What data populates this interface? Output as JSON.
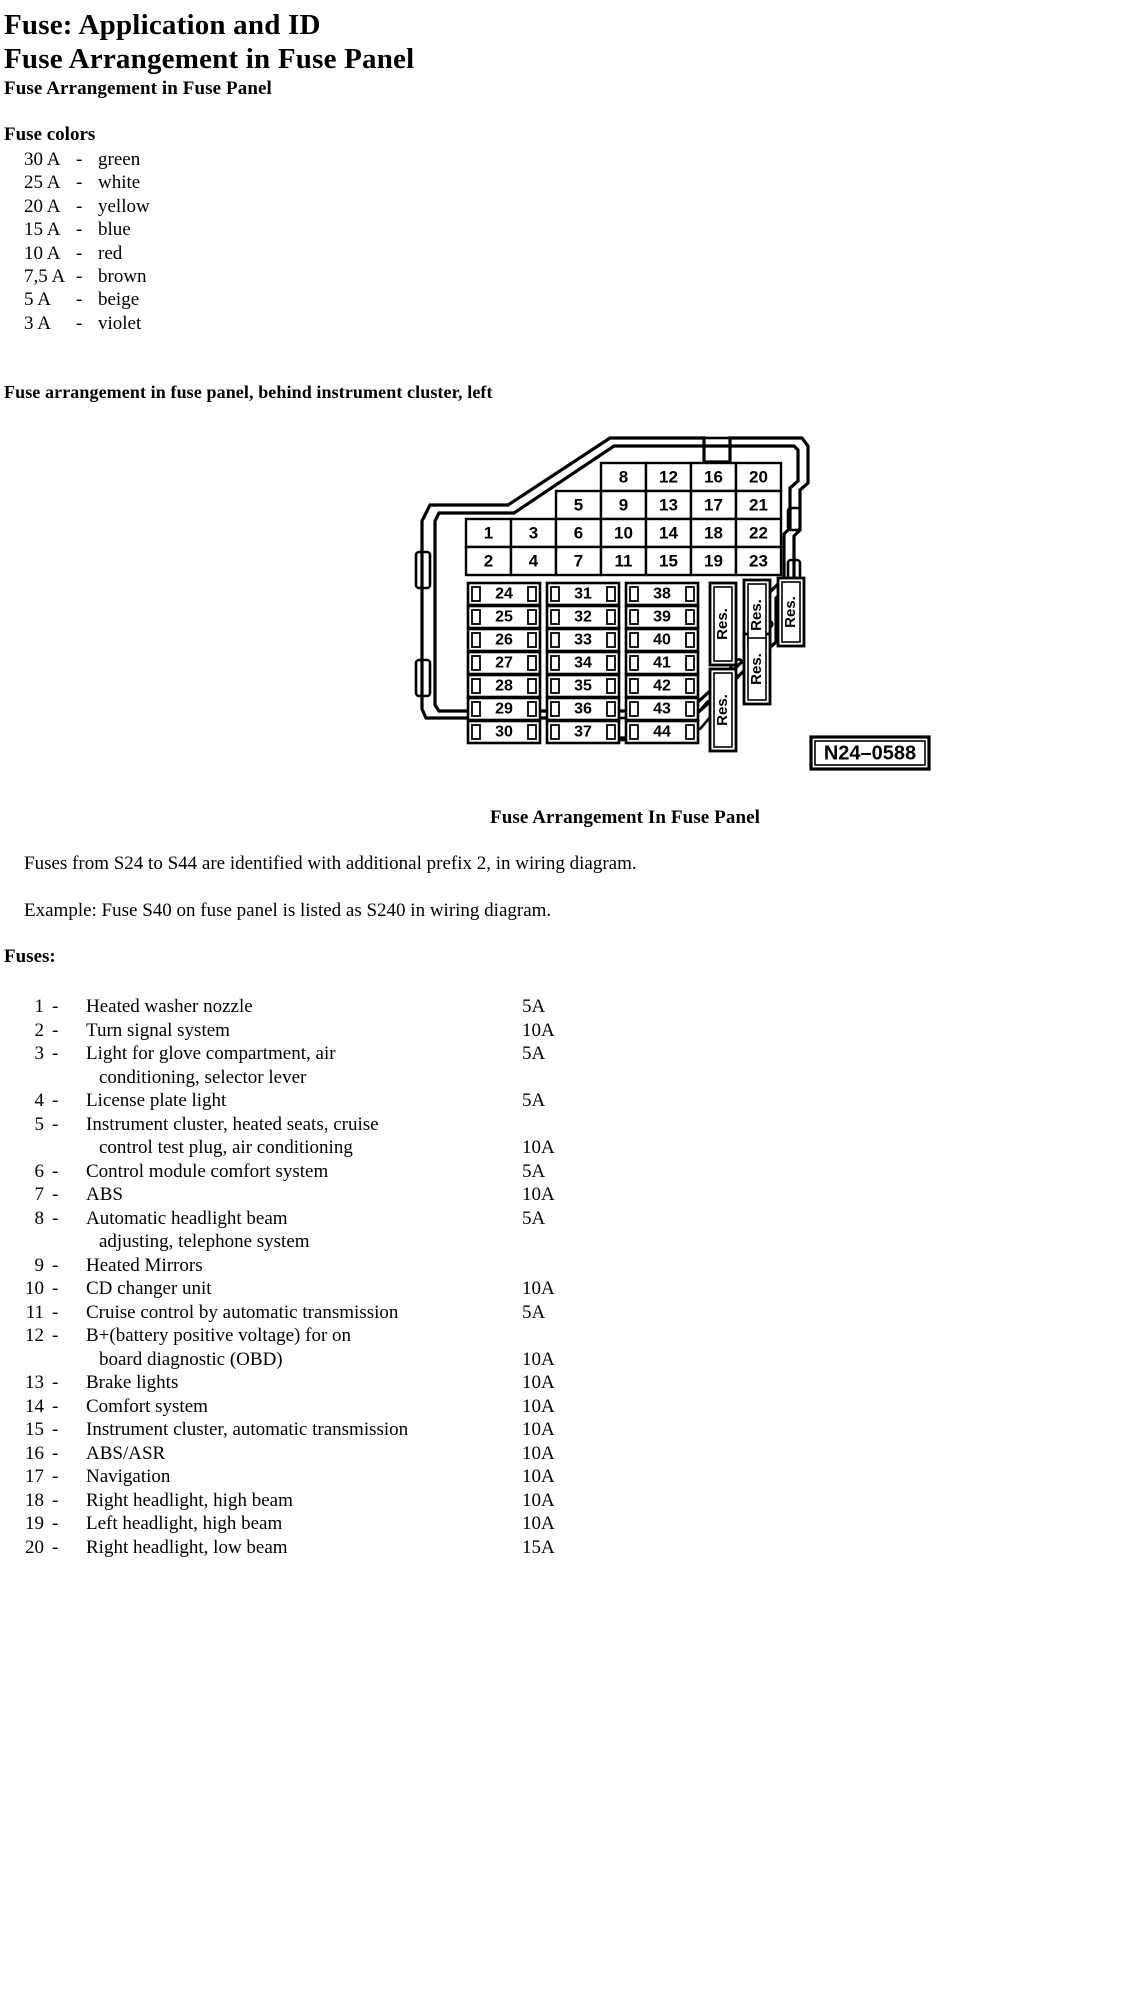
{
  "document": {
    "title_line_1": "Fuse: Application and ID",
    "title_line_2": "Fuse Arrangement in Fuse Panel",
    "subtitle": "Fuse Arrangement in Fuse Panel"
  },
  "fuse_colors": {
    "heading": "Fuse colors",
    "rows": [
      {
        "amp": "30 A",
        "dash": "-",
        "color": "green"
      },
      {
        "amp": "25 A",
        "dash": "-",
        "color": "white"
      },
      {
        "amp": "20 A",
        "dash": "-",
        "color": "yellow"
      },
      {
        "amp": "15 A",
        "dash": "-",
        "color": "blue"
      },
      {
        "amp": "10 A",
        "dash": "-",
        "color": "red"
      },
      {
        "amp": "7,5 A",
        "dash": "-",
        "color": "brown"
      },
      {
        "amp": "5 A",
        "dash": "-",
        "color": "beige"
      },
      {
        "amp": "3 A",
        "dash": "-",
        "color": "violet"
      }
    ]
  },
  "diagram": {
    "heading": "Fuse arrangement in fuse panel, behind instrument cluster, left",
    "caption": "Fuse Arrangement In Fuse Panel",
    "part_number": "N24–0588",
    "reserve_label": "Res.",
    "top_grid": {
      "row_1": [
        "8",
        "12",
        "16",
        "20"
      ],
      "row_2": [
        "5",
        "9",
        "13",
        "17",
        "21"
      ],
      "row_3": [
        "1",
        "3",
        "6",
        "10",
        "14",
        "18",
        "22"
      ],
      "row_4": [
        "2",
        "4",
        "7",
        "11",
        "15",
        "19",
        "23"
      ]
    },
    "bottom_grid": {
      "column_1": [
        "24",
        "25",
        "26",
        "27",
        "28",
        "29",
        "30"
      ],
      "column_2": [
        "31",
        "32",
        "33",
        "34",
        "35",
        "36",
        "37"
      ],
      "column_3": [
        "38",
        "39",
        "40",
        "41",
        "42",
        "43",
        "44"
      ]
    },
    "reserve_slots_count": 5
  },
  "notes": {
    "note_1": "Fuses from S24 to S44 are identified with additional prefix 2, in wiring diagram.",
    "note_2": "Example: Fuse S40 on fuse panel is listed as S240 in wiring diagram."
  },
  "fuses": {
    "heading": "Fuses:",
    "items": [
      {
        "num": "1",
        "dash": "-",
        "desc": "Heated washer nozzle",
        "desc2": "",
        "amp": "5A",
        "amp_on_line": 1
      },
      {
        "num": "2",
        "dash": "-",
        "desc": "Turn signal system",
        "desc2": "",
        "amp": "10A",
        "amp_on_line": 1
      },
      {
        "num": "3",
        "dash": "-",
        "desc": "Light for glove compartment, air",
        "desc2": "conditioning, selector lever",
        "amp": "5A",
        "amp_on_line": 1
      },
      {
        "num": "4",
        "dash": "-",
        "desc": "License plate light",
        "desc2": "",
        "amp": "5A",
        "amp_on_line": 1
      },
      {
        "num": "5",
        "dash": "-",
        "desc": "Instrument cluster, heated seats, cruise",
        "desc2": "control test plug, air conditioning",
        "amp": "10A",
        "amp_on_line": 2
      },
      {
        "num": "6",
        "dash": "-",
        "desc": "Control module comfort system",
        "desc2": "",
        "amp": "5A",
        "amp_on_line": 1
      },
      {
        "num": "7",
        "dash": "-",
        "desc": "ABS",
        "desc2": "",
        "amp": "10A",
        "amp_on_line": 1
      },
      {
        "num": "8",
        "dash": "-",
        "desc": "Automatic headlight beam",
        "desc2": "adjusting, telephone system",
        "amp": "5A",
        "amp_on_line": 1
      },
      {
        "num": "9",
        "dash": "-",
        "desc": "Heated Mirrors",
        "desc2": "",
        "amp": "",
        "amp_on_line": 1
      },
      {
        "num": "10",
        "dash": "-",
        "desc": "CD changer unit",
        "desc2": "",
        "amp": "10A",
        "amp_on_line": 1
      },
      {
        "num": "11",
        "dash": "-",
        "desc": "Cruise control by automatic transmission",
        "desc2": "",
        "amp": "5A",
        "amp_on_line": 1
      },
      {
        "num": "12",
        "dash": "-",
        "desc": "B+(battery positive voltage) for on",
        "desc2": "board diagnostic (OBD)",
        "amp": "10A",
        "amp_on_line": 2
      },
      {
        "num": "13",
        "dash": "-",
        "desc": "Brake lights",
        "desc2": "",
        "amp": "10A",
        "amp_on_line": 1
      },
      {
        "num": "14",
        "dash": "-",
        "desc": "Comfort system",
        "desc2": "",
        "amp": "10A",
        "amp_on_line": 1
      },
      {
        "num": "15",
        "dash": "-",
        "desc": "Instrument cluster, automatic transmission",
        "desc2": "",
        "amp": "10A",
        "amp_on_line": 1
      },
      {
        "num": "16",
        "dash": "-",
        "desc": "ABS/ASR",
        "desc2": "",
        "amp": "10A",
        "amp_on_line": 1
      },
      {
        "num": "17",
        "dash": "-",
        "desc": "Navigation",
        "desc2": "",
        "amp": "10A",
        "amp_on_line": 1
      },
      {
        "num": "18",
        "dash": "-",
        "desc": "Right headlight, high beam",
        "desc2": "",
        "amp": "10A",
        "amp_on_line": 1
      },
      {
        "num": "19",
        "dash": "-",
        "desc": "Left headlight, high beam",
        "desc2": "",
        "amp": "10A",
        "amp_on_line": 1
      },
      {
        "num": "20",
        "dash": "-",
        "desc": "Right headlight, low beam",
        "desc2": "",
        "amp": "15A",
        "amp_on_line": 1
      }
    ]
  },
  "colors": {
    "ink": "#000000",
    "paper": "#ffffff"
  }
}
